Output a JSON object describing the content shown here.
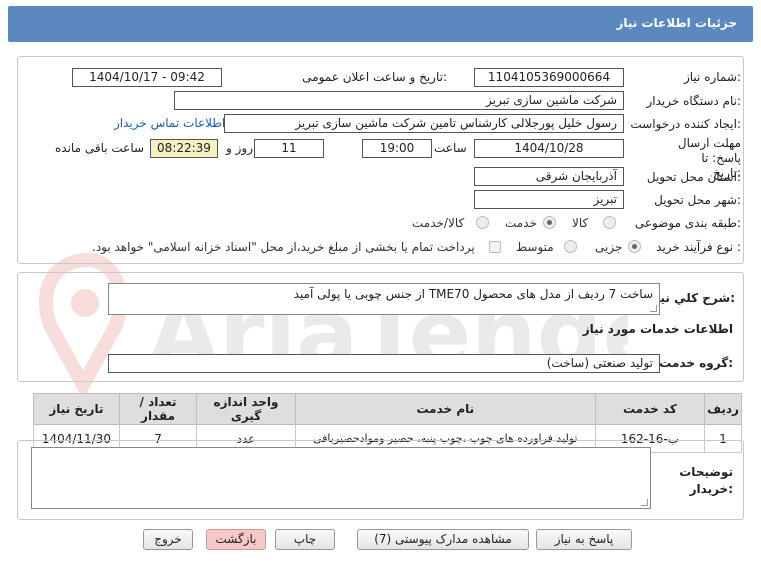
{
  "header": {
    "title": "جزئیات اطلاعات نیاز"
  },
  "form": {
    "need_number_label": "شماره نیاز:",
    "need_number": "1104105369000664",
    "announce_label": "تاریخ و ساعت اعلان عمومی:",
    "announce_value": "1404/10/17 - 09:42",
    "buyer_org_label": "نام دستگاه خریدار:",
    "buyer_org": "شرکت ماشین سازی تبریز",
    "creator_label": "ایجاد کننده درخواست:",
    "creator": "رسول خلیل پورجلالی کارشناس تامین شرکت ماشین سازی تبریز",
    "contact_link": "اطلاعات تماس خریدار",
    "deadline_label": "مهلت ارسال پاسخ: تا تاریخ:",
    "deadline_date": "1404/10/28",
    "time_label": "ساعت",
    "deadline_time": "19:00",
    "days_value": "11",
    "days_label": "روز و",
    "remaining_time": "08:22:39",
    "remaining_label": "ساعت باقی مانده",
    "province_label": "استان محل تحویل:",
    "province": "آذربایجان شرقی",
    "city_label": "شهر محل تحویل:",
    "city": "تبریز",
    "category_label": "طبقه بندی موضوعی:",
    "category_options": [
      "کالا",
      "خدمت",
      "کالا/خدمت"
    ],
    "process_label": "نوع فرآیند خرید :",
    "process_options": [
      "جزیی",
      "متوسط"
    ],
    "payment_note": "پرداخت تمام یا بخشی از مبلغ خرید،از محل \"اسناد خزانه اسلامی\" خواهد بود."
  },
  "summary": {
    "label": "شرح کلي نياز:",
    "text": "ساخت 7 ردیف از مدل های محصول TME70 از جنس چوبی یا پولی آمید"
  },
  "services": {
    "section_title": "اطلاعات خدمات مورد نیاز",
    "group_label": "گروه خدمت:",
    "group_value": "تولید صنعتی (ساخت)",
    "columns": [
      "ردیف",
      "کد خدمت",
      "نام خدمت",
      "واحد اندازه گیری",
      "تعداد / مقدار",
      "تاریخ نیاز"
    ],
    "rows": [
      [
        "1",
        "ب-16-162",
        "تولید فراورده های چوب ،چوب پنبه، حصیر وموادحصیربافی",
        "عدد",
        "7",
        "1404/11/30"
      ]
    ]
  },
  "buyer_notes": {
    "label": "توضیحات خریدار:"
  },
  "buttons": {
    "reply": "پاسخ به نیاز",
    "attachments": "مشاهده مدارک پیوستی (7)",
    "print": "چاپ",
    "back": "بازگشت",
    "exit": "خروج"
  },
  "watermark": {
    "text": "AriaTender.net"
  },
  "colors": {
    "header_bg": "#5b88bf",
    "link": "#1a5fb4",
    "remaining_bg": "#f5f0c0",
    "exit_bg": "#f6c8c8"
  }
}
